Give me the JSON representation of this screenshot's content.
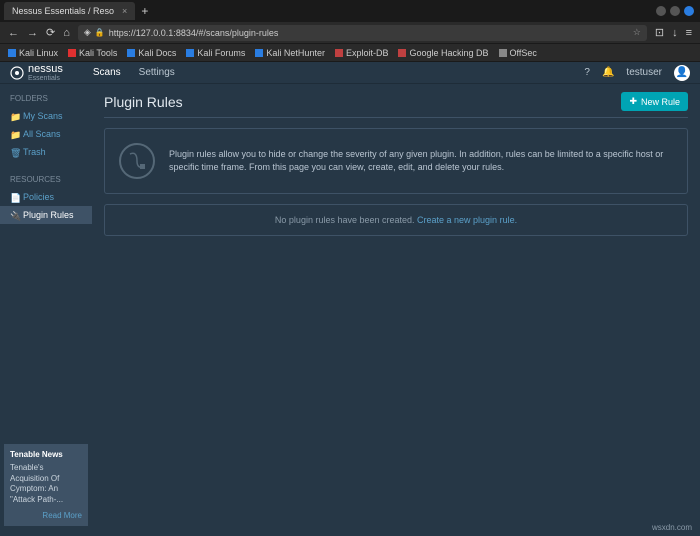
{
  "browser": {
    "tab_title": "Nessus Essentials / Reso",
    "url": "https://127.0.0.1:8834/#/scans/plugin-rules",
    "bookmarks": [
      {
        "label": "Kali Linux",
        "color": "#2a7de1"
      },
      {
        "label": "Kali Tools",
        "color": "#e03030"
      },
      {
        "label": "Kali Docs",
        "color": "#2a7de1"
      },
      {
        "label": "Kali Forums",
        "color": "#2a7de1"
      },
      {
        "label": "Kali NetHunter",
        "color": "#2a7de1"
      },
      {
        "label": "Exploit-DB",
        "color": "#c04040"
      },
      {
        "label": "Google Hacking DB",
        "color": "#c04040"
      },
      {
        "label": "OffSec",
        "color": "#888"
      }
    ]
  },
  "app": {
    "brand": "nessus",
    "brand_sub": "Essentials",
    "nav": {
      "scans": "Scans",
      "settings": "Settings"
    },
    "user": "testuser"
  },
  "sidebar": {
    "folders_label": "FOLDERS",
    "resources_label": "RESOURCES",
    "folders": [
      {
        "label": "My Scans"
      },
      {
        "label": "All Scans"
      },
      {
        "label": "Trash"
      }
    ],
    "resources": [
      {
        "label": "Policies"
      },
      {
        "label": "Plugin Rules"
      }
    ]
  },
  "page": {
    "title": "Plugin Rules",
    "new_btn": "New Rule",
    "info_text": "Plugin rules allow you to hide or change the severity of any given plugin. In addition, rules can be limited to a specific host or specific time frame. From this page you can view, create, edit, and delete your rules.",
    "empty_prefix": "No plugin rules have been created. ",
    "empty_link": "Create a new plugin rule."
  },
  "news": {
    "heading": "Tenable News",
    "title": "Tenable's Acquisition Of Cymptom: An \"Attack Path-...",
    "more": "Read More"
  },
  "watermark": "wsxdn.com"
}
